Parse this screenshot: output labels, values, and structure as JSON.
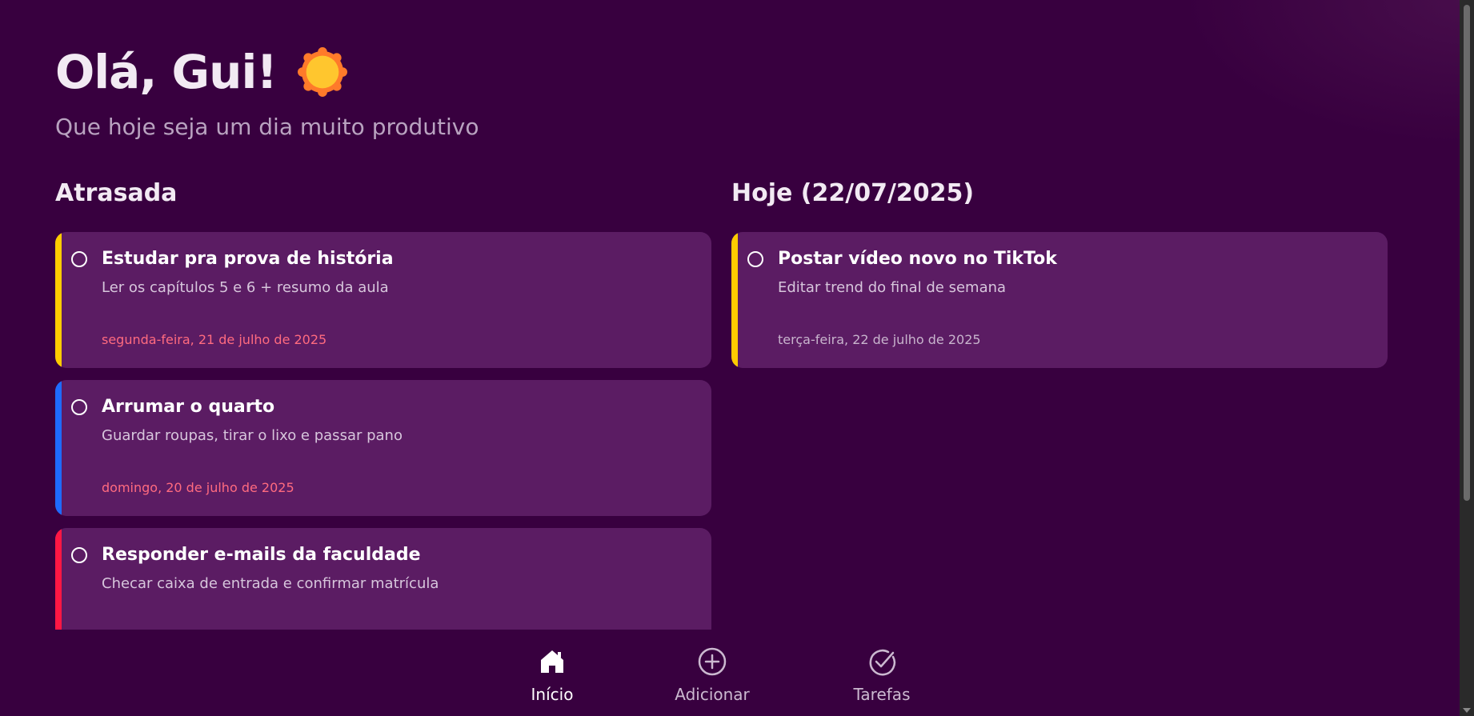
{
  "header": {
    "greeting": "Olá, Gui!",
    "sun_icon": "sun-icon",
    "subtitle": "Que hoje seja um dia muito produtivo"
  },
  "colors": {
    "background": "#38003f",
    "card": "#5b1c63",
    "overdue_date": "#ff6b7f",
    "today_date": "#c8b4cd",
    "priority_yellow": "#ffcc00",
    "priority_blue": "#1e6bff",
    "priority_red": "#ff1744"
  },
  "overdue": {
    "title": "Atrasada",
    "tasks": [
      {
        "title": "Estudar pra prova de história",
        "description": "Ler os capítulos 5 e 6 + resumo da aula",
        "date": "segunda-feira, 21 de julho de 2025",
        "accent": "#ffcc00"
      },
      {
        "title": "Arrumar o quarto",
        "description": "Guardar roupas, tirar o lixo e passar pano",
        "date": "domingo, 20 de julho de 2025",
        "accent": "#1e6bff"
      },
      {
        "title": "Responder e-mails da faculdade",
        "description": "Checar caixa de entrada e confirmar matrícula",
        "date": "",
        "accent": "#ff1744"
      }
    ]
  },
  "today": {
    "title": "Hoje (22/07/2025)",
    "tasks": [
      {
        "title": "Postar vídeo novo no TikTok",
        "description": "Editar trend do final de semana",
        "date": "terça-feira, 22 de julho de 2025",
        "accent": "#ffcc00"
      }
    ]
  },
  "nav": {
    "items": [
      {
        "label": "Início",
        "icon": "home-icon",
        "active": true
      },
      {
        "label": "Adicionar",
        "icon": "plus-circle-icon",
        "active": false
      },
      {
        "label": "Tarefas",
        "icon": "check-circle-icon",
        "active": false
      }
    ]
  }
}
